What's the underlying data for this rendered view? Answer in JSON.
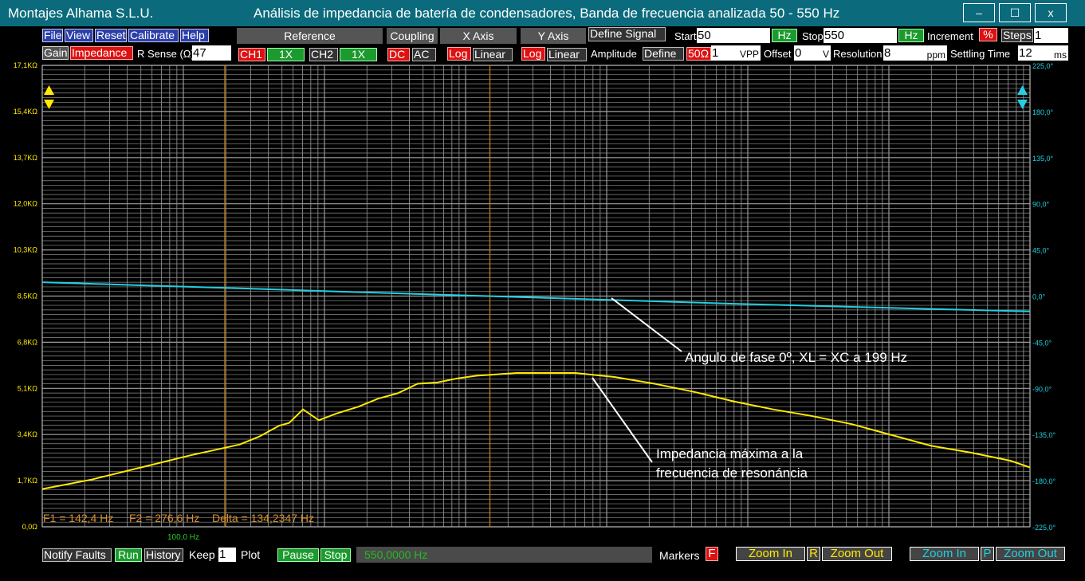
{
  "window": {
    "app_name": "Montajes Alhama S.L.U.",
    "caption": "Análisis de impedancia de batería de condensadores,  Banda de frecuencia analizada 50 - 550 Hz",
    "controls": [
      "–",
      "☐",
      "x"
    ]
  },
  "menu": {
    "file": "File",
    "view": "View",
    "reset": "Reset",
    "calibrate": "Calibrate",
    "help": "Help"
  },
  "toolbar": {
    "gain": "Gain",
    "impedance": "Impedance",
    "r_sense_label": "R Sense (Ω)",
    "r_sense_value": "47",
    "reference": "Reference",
    "ch1": "CH1",
    "ch1_mult": "1X",
    "ch2": "CH2",
    "ch2_mult": "1X",
    "coupling": "Coupling",
    "dc": "DC",
    "ac": "AC",
    "x_axis": "X Axis",
    "x_log": "Log",
    "x_linear": "Linear",
    "y_axis": "Y Axis",
    "y_log": "Log",
    "y_linear": "Linear",
    "define_signal": "Define Signal",
    "amplitude": "Amplitude",
    "define": "Define",
    "ohm50": "50Ω",
    "amplitude_value": "1",
    "vpp": "VPP",
    "offset_label": "Offset",
    "offset_value": "0",
    "offset_unit": "V",
    "start_label": "Start",
    "start_value": "50",
    "start_unit": "Hz",
    "stop_label": "Stop",
    "stop_value": "550",
    "stop_unit": "Hz",
    "increment_label": "Increment",
    "increment_unit": "%",
    "steps_label": "Steps",
    "steps_value": "1",
    "resolution_label": "Resolution",
    "resolution_value": "8",
    "resolution_unit": "ppm",
    "settling_label": "Settling Time",
    "settling_value": "12",
    "settling_unit": "ms"
  },
  "markers_text": {
    "f1": "F1 = 142,4 Hz",
    "f2": "F2 = 276,6 Hz",
    "delta": "Delta = 134,2347 Hz"
  },
  "annotations": {
    "phase": "Angulo de fase 0º, XL = XC a 199 Hz",
    "impedance_line1": "Impedancia máxima a la",
    "impedance_line2": "frecuencia de resonáncia"
  },
  "bottom_bar": {
    "notify_faults": "Notify Faults",
    "run": "Run",
    "history": "History",
    "keep": "Keep",
    "keep_value": "1",
    "plot": "Plot",
    "pause": "Pause",
    "stop": "Stop",
    "frequency_readout": "550,0000 Hz",
    "markers": "Markers",
    "markers_flag": "F",
    "zoom_in_left": "Zoom In",
    "r_flag": "R",
    "zoom_out_left": "Zoom Out",
    "zoom_in_right": "Zoom In",
    "p_flag": "P",
    "zoom_out_right": "Zoom Out"
  },
  "colors": {
    "titlebar": "#0b6b7c",
    "impedance_trace": "#ffea00",
    "phase_trace": "#22d0e0",
    "marker_line": "#c87a10",
    "grid": "#8c8c8c",
    "red_button": "#d11111",
    "green_button": "#1b9a2e"
  },
  "chart_data": {
    "type": "line",
    "x_scale": "linear",
    "xlim": [
      50,
      550
    ],
    "x_tick_label": "100,0 Hz",
    "y_left": {
      "ticks": [
        "0,0Ω",
        "1,7KΩ",
        "3,4KΩ",
        "5,1KΩ",
        "6,8KΩ",
        "8,5KΩ",
        "10,3KΩ",
        "12,0KΩ",
        "13,7KΩ",
        "15,4KΩ",
        "17,1KΩ"
      ],
      "ylim": [
        0,
        17.1
      ],
      "unit": "KΩ"
    },
    "y_right": {
      "ticks": [
        "-225,0°",
        "-180,0°",
        "-135,0°",
        "-90,0°",
        "-45,0°",
        "0,0°",
        "45,0°",
        "90,0°",
        "135,0°",
        "180,0°",
        "225,0°"
      ],
      "ylim": [
        -225,
        225
      ],
      "unit": "°"
    },
    "markers": [
      142.4,
      276.6
    ],
    "grid": true,
    "series": [
      {
        "axis": "left",
        "color": "#ffea00",
        "x": [
          50,
          75,
          100,
          125,
          150,
          160,
          165,
          170,
          175,
          182,
          190,
          199,
          210,
          220,
          230,
          240,
          250,
          260,
          270,
          280,
          290,
          300,
          320,
          340,
          360,
          380,
          400,
          420,
          440,
          460,
          480,
          500,
          520,
          540,
          550
        ],
        "y": [
          1.4,
          1.75,
          2.2,
          2.65,
          3.05,
          3.35,
          3.55,
          3.75,
          3.85,
          4.35,
          3.95,
          4.2,
          4.45,
          4.75,
          4.95,
          5.3,
          5.35,
          5.5,
          5.6,
          5.65,
          5.7,
          5.7,
          5.7,
          5.55,
          5.3,
          5.0,
          4.65,
          4.35,
          4.1,
          3.8,
          3.4,
          3.0,
          2.75,
          2.45,
          2.2
        ]
      },
      {
        "axis": "right",
        "color": "#22d0e0",
        "x": [
          50,
          100,
          150,
          199,
          250,
          300,
          350,
          400,
          450,
          500,
          550
        ],
        "y": [
          13.5,
          10.5,
          7.5,
          4.5,
          1.5,
          -1.5,
          -4.5,
          -7.5,
          -10.0,
          -12.5,
          -15.0
        ]
      }
    ]
  }
}
